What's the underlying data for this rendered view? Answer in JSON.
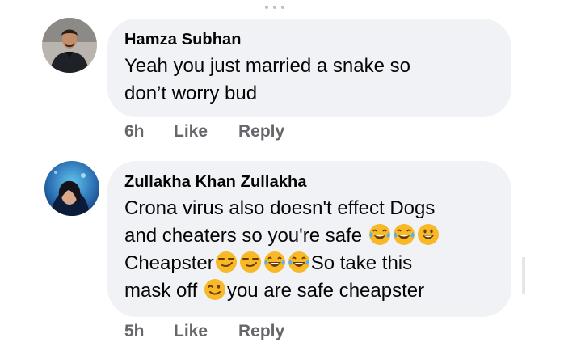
{
  "comments": [
    {
      "author": "Hamza Subhan",
      "lines": [
        "Yeah you just married a snake so",
        "don’t worry bud"
      ],
      "time": "6h",
      "like_label": "Like",
      "reply_label": "Reply"
    },
    {
      "author": "Zullakha Khan Zullakha",
      "line1": "Crona virus also doesn't effect Dogs",
      "line2": "and cheaters so you're safe",
      "line3a": "Cheapster",
      "line3b": "So take this",
      "line4a": "mask off",
      "line4b": "you are safe cheapster",
      "time": "5h",
      "like_label": "Like",
      "reply_label": "Reply"
    }
  ],
  "icons": [
    "laughing-tears-emoji",
    "grinning-emoji",
    "smirk-emoji",
    "winking-emoji"
  ]
}
